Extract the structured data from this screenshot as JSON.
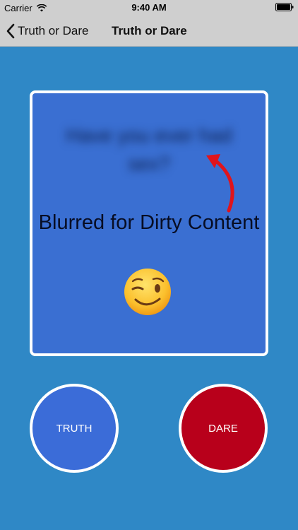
{
  "status_bar": {
    "carrier": "Carrier",
    "time": "9:40 AM",
    "icons": [
      "wifi-icon",
      "battery-icon"
    ]
  },
  "nav": {
    "back_label": "Truth or Dare",
    "title": "Truth or Dare"
  },
  "card": {
    "question": "Have you ever had sex?",
    "caption": "Blurred for Dirty Content",
    "emoji": "winking-face-icon"
  },
  "buttons": {
    "truth_label": "TRUTH",
    "dare_label": "DARE"
  },
  "colors": {
    "background": "#2f88c6",
    "card": "#3a6fd2",
    "truth": "#3b6cd8",
    "dare": "#b8001b",
    "arrow": "#e0141c"
  }
}
